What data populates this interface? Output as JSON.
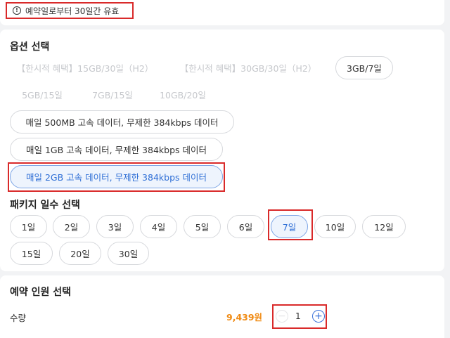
{
  "notice": {
    "icon": "info-icon",
    "text": "예약일로부터 30일간 유효"
  },
  "options": {
    "title": "옵션 선택",
    "chips": [
      {
        "label": "【한시적 혜택】15GB/30일（H2）",
        "state": "disabled"
      },
      {
        "label": "【한시적 혜택】30GB/30일（H2）",
        "state": "disabled"
      },
      {
        "label": "3GB/7일",
        "state": "normal"
      },
      {
        "label": "5GB/15일",
        "state": "disabled"
      },
      {
        "label": "7GB/15일",
        "state": "disabled"
      },
      {
        "label": "10GB/20일",
        "state": "disabled"
      },
      {
        "label": "매일 500MB 고속 데이터, 무제한 384kbps 데이터",
        "state": "normal"
      },
      {
        "label": "매일 1GB 고속 데이터, 무제한 384kbps 데이터",
        "state": "normal"
      },
      {
        "label": "매일 2GB 고속 데이터, 무제한 384kbps 데이터",
        "state": "selected"
      }
    ]
  },
  "days": {
    "title": "패키지 일수 선택",
    "chips": [
      {
        "label": "1일",
        "state": "normal"
      },
      {
        "label": "2일",
        "state": "normal"
      },
      {
        "label": "3일",
        "state": "normal"
      },
      {
        "label": "4일",
        "state": "normal"
      },
      {
        "label": "5일",
        "state": "normal"
      },
      {
        "label": "6일",
        "state": "normal"
      },
      {
        "label": "7일",
        "state": "selected"
      },
      {
        "label": "10일",
        "state": "normal"
      },
      {
        "label": "12일",
        "state": "normal"
      },
      {
        "label": "15일",
        "state": "normal"
      },
      {
        "label": "20일",
        "state": "normal"
      },
      {
        "label": "30일",
        "state": "normal"
      }
    ]
  },
  "people": {
    "title": "예약 인원 선택",
    "qty_label": "수량",
    "price": "9,439원",
    "quantity": "1",
    "minus_icon": "minus-icon",
    "plus_icon": "plus-icon"
  },
  "colors": {
    "accent": "#2f6fd6",
    "price": "#f08a12",
    "highlight": "#d92a2a"
  }
}
